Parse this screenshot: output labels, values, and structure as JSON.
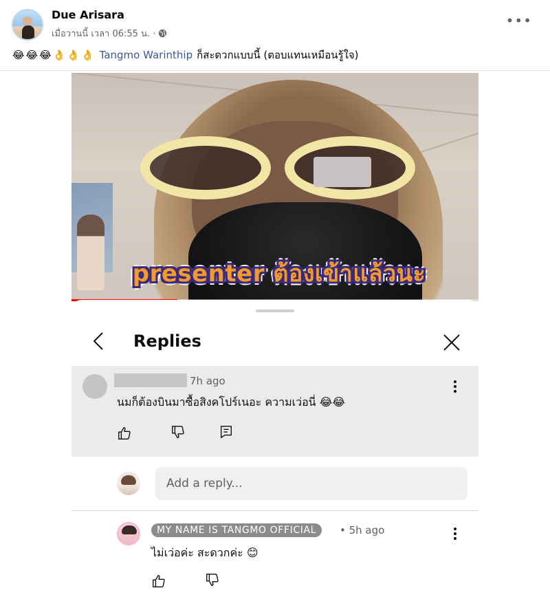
{
  "post": {
    "author": "Due Arisara",
    "timestamp": "เมื่อวานนี้ เวลา 06:55 น. ·",
    "emojis": [
      "😂",
      "😂",
      "😂",
      "👌",
      "👌",
      "👌"
    ],
    "mention": "Tangmo Warinthip",
    "text": "ก็สะดวกแบบนี้ (ตอบแทนเหมือนรู้ใจ)",
    "more_label": "•••"
  },
  "video": {
    "caption": "presenter ต้องเข้าแล้วนะ",
    "progress": 0.26
  },
  "replies_sheet": {
    "title": "Replies",
    "parent_comment": {
      "time": "7h ago",
      "text": "นมก็ต้องบินมาซื้อสิงคโปร์เนอะ ความเว่อนี่ 😂😂"
    },
    "reply_placeholder": "Add a reply...",
    "reply": {
      "channel": "MY NAME IS TANGMO OFFICIAL",
      "time": "• 5h ago",
      "text": "ไม่เว่อค่ะ สะดวกค่ะ 😊"
    }
  },
  "colors": {
    "mention": "#385898",
    "progress": "#ff0000",
    "caption_fill": "#f29a2e",
    "caption_outline": "#3a2a7a"
  },
  "icons": [
    "globe-icon",
    "back-icon",
    "close-icon",
    "thumbs-up-icon",
    "thumbs-down-icon",
    "comment-icon",
    "more-vertical-icon"
  ]
}
